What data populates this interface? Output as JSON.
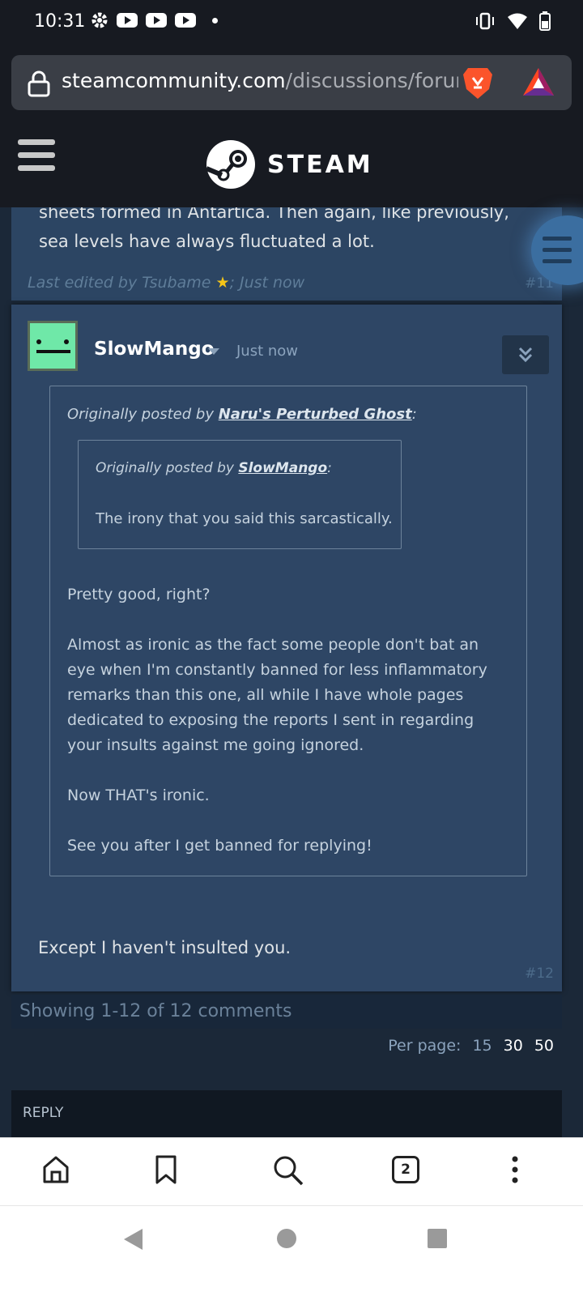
{
  "status_bar": {
    "time": "10:31"
  },
  "browser": {
    "url_domain": "steamcommunity.com",
    "url_path": "/discussions/forur",
    "tab_count": "2"
  },
  "header": {
    "brand": "STEAM"
  },
  "prev_post": {
    "text": "sheets formed in Antartica. Then again, like previously, sea levels have always fluctuated a lot.",
    "edit_prefix": "Last edited by ",
    "edit_user": "Tsubame",
    "edit_suffix": "; Just now",
    "number": "#11"
  },
  "post": {
    "author": "SlowMango",
    "time": "Just now",
    "quote": {
      "prefix": "Originally posted by ",
      "author": "Naru's Perturbed Ghost",
      "suffix": ":",
      "inner_prefix": "Originally posted by ",
      "inner_author": "SlowMango",
      "inner_suffix": ":",
      "inner_text": "The irony that you said this sarcastically.",
      "paragraphs": [
        "Pretty good, right?",
        "Almost as ironic as the fact some people don't bat an eye when I'm constantly banned for less inflammatory remarks than this one, all while I have whole pages dedicated to exposing the reports I sent in regarding your insults against me going ignored.",
        "Now THAT's ironic.",
        "See you after I get banned for replying!"
      ]
    },
    "reply": "Except I haven't insulted you.",
    "number": "#12"
  },
  "thread_footer": {
    "showing": "Showing 1-12 of 12 comments",
    "per_page_label": "Per page:",
    "per_page_options": [
      "15",
      "30",
      "50"
    ],
    "reply_label": "REPLY"
  },
  "colors": {
    "page_bg": "#1b2838",
    "post_bg": "#2e4665",
    "header_bg": "#171a21"
  }
}
